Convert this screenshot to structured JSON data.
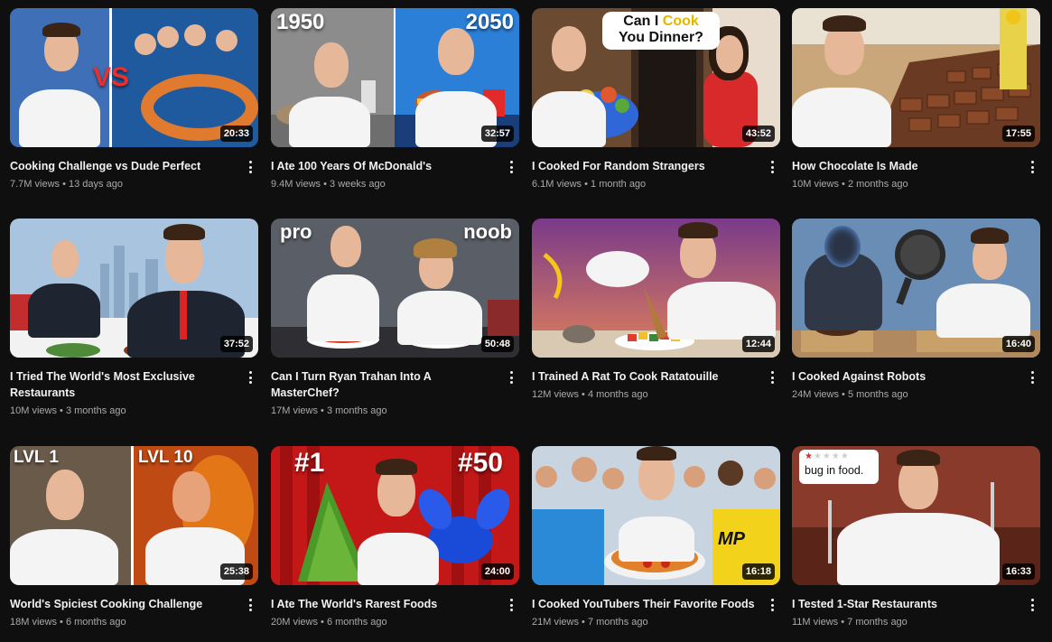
{
  "videos": [
    {
      "title": "Cooking Challenge vs Dude Perfect",
      "views": "7.7M views",
      "age": "13 days ago",
      "duration": "20:33",
      "overlay": [
        "VS"
      ]
    },
    {
      "title": "I Ate 100 Years Of McDonald's",
      "views": "9.4M views",
      "age": "3 weeks ago",
      "duration": "32:57",
      "overlay": [
        "1950",
        "2050"
      ]
    },
    {
      "title": "I Cooked For Random Strangers",
      "views": "6.1M views",
      "age": "1 month ago",
      "duration": "43:52",
      "overlay": [
        "Can I",
        "Cook",
        "You Dinner?"
      ]
    },
    {
      "title": "How Chocolate Is Made",
      "views": "10M views",
      "age": "2 months ago",
      "duration": "17:55",
      "overlay": []
    },
    {
      "title": "I Tried The World's Most Exclusive Restaurants",
      "views": "10M views",
      "age": "3 months ago",
      "duration": "37:52",
      "overlay": []
    },
    {
      "title": "Can I Turn Ryan Trahan Into A MasterChef?",
      "views": "17M views",
      "age": "3 months ago",
      "duration": "50:48",
      "overlay": [
        "pro",
        "noob"
      ]
    },
    {
      "title": "I Trained A Rat To Cook Ratatouille",
      "views": "12M views",
      "age": "4 months ago",
      "duration": "12:44",
      "overlay": []
    },
    {
      "title": "I Cooked Against Robots",
      "views": "24M views",
      "age": "5 months ago",
      "duration": "16:40",
      "overlay": []
    },
    {
      "title": "World's Spiciest Cooking Challenge",
      "views": "18M views",
      "age": "6 months ago",
      "duration": "25:38",
      "overlay": [
        "LVL 1",
        "LVL 10"
      ]
    },
    {
      "title": "I Ate The World's Rarest Foods",
      "views": "20M views",
      "age": "6 months ago",
      "duration": "24:00",
      "overlay": [
        "#1",
        "#50"
      ]
    },
    {
      "title": "I Cooked YouTubers Their Favorite Foods",
      "views": "21M views",
      "age": "7 months ago",
      "duration": "16:18",
      "overlay": [
        "MP"
      ]
    },
    {
      "title": "I Tested 1-Star Restaurants",
      "views": "11M views",
      "age": "7 months ago",
      "duration": "16:33",
      "overlay": [
        "bug in food."
      ]
    }
  ],
  "separator": "•",
  "colors": {
    "background": "#0f0f0f",
    "title": "#f1f1f1",
    "meta": "#aaaaaa",
    "duration_bg": "#000000"
  },
  "icons": {
    "menu": "more-vert-icon"
  }
}
